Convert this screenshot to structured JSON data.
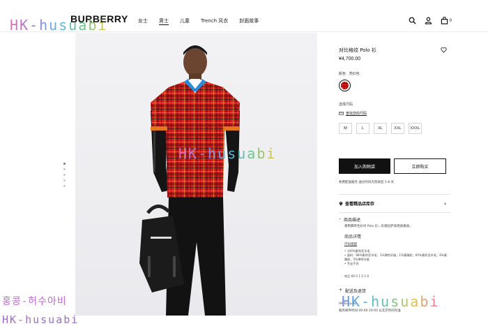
{
  "brand": "BURBERRY",
  "nav": [
    "女士",
    "男士",
    "儿童",
    "Trench 风衣",
    "封面故事"
  ],
  "nav_active_index": 1,
  "header_icons": [
    "search-icon",
    "user-icon",
    "bag-icon"
  ],
  "cart_count": "0",
  "product": {
    "title": "对比格纹 Polo 衫",
    "price": "¥4,700.00",
    "color_label": "颜色",
    "color_value": "亮红色",
    "swatch_color": "#d11f1f",
    "size_label": "选择尺码",
    "size_guide": "查找您的尺码",
    "sizes": [
      "M",
      "L",
      "XL",
      "XXL",
      "XXXL"
    ],
    "add_to_bag": "加入购物袋",
    "buy_now": "立即购买",
    "shipping": "免费配送服务 送达时间为签收后 5-8 天",
    "store_check": "查看精品店库存",
    "section_desc": "商品描述",
    "desc_text": "素荆棘单毛衫衬 Polo 衫，彩缀拉萨高感质素质。",
    "section_details": "商品详情",
    "details_sub": "尺码搭配",
    "bullets": [
      "100%素利亚羊毛",
      "面料：98%素利亚羊毛，1%弹性纤维，1%素腈纶；95%素利亚羊毛，8%素腈纶，5%弹性纤维",
      "专业干洗"
    ],
    "item_code": "商品 80 0 1 0 2 8",
    "section_delivery": "配送及退货",
    "bottom_line1": "HK-husuabi",
    "bottom_line2": "服务邮件时间 09:00-19:00 以北京时间为准"
  },
  "carousel": {
    "dots": 5,
    "active": 0
  },
  "watermarks": {
    "top_left": "HK-husuabi",
    "center": "HK-husuabi",
    "bottom_right": "HK-husuabi",
    "korean": "홍콩-허수아비",
    "bottom_left": "HK-husuabi"
  },
  "colors": {
    "primary_button": "#111111",
    "shirt_red": "#d11f1f"
  }
}
